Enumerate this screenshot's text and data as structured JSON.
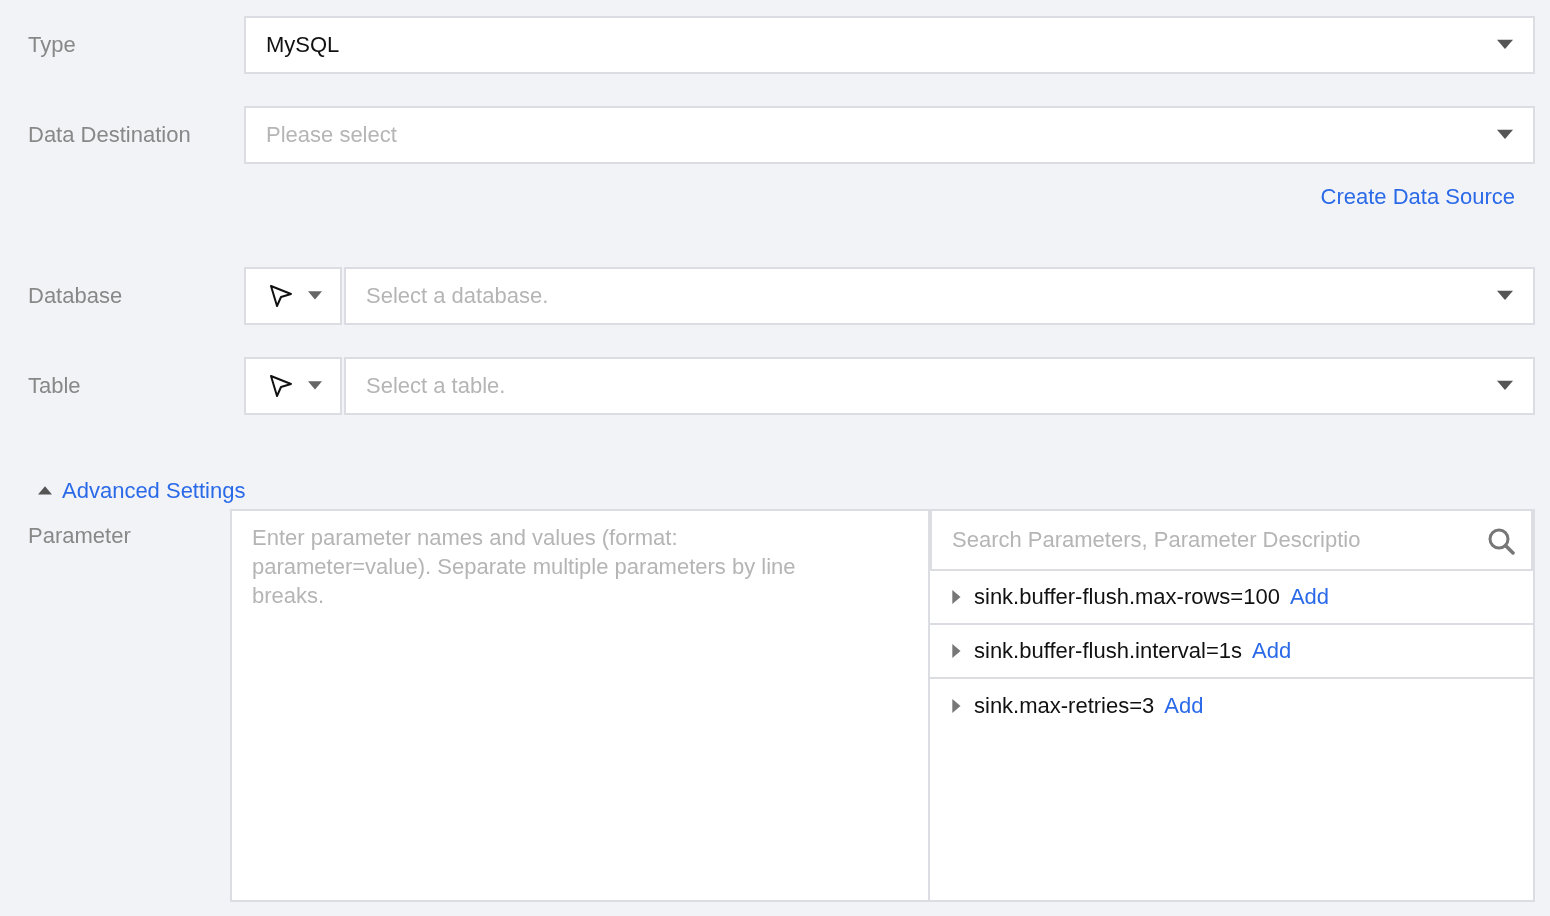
{
  "fields": [
    {
      "label": "Type",
      "kind": "select",
      "value": "MySQL"
    },
    {
      "label": "Data Destination",
      "kind": "select",
      "placeholder": "Please select",
      "link": "Create Data Source"
    },
    {
      "label": "Database",
      "kind": "picker",
      "placeholder": "Select a database."
    },
    {
      "label": "Table",
      "kind": "picker",
      "placeholder": "Select a table."
    }
  ],
  "advanced": {
    "label": "Advanced Settings",
    "expanded": true
  },
  "parameter": {
    "label": "Parameter",
    "placeholder": "Enter parameter names and values (format: parameter=value). Separate multiple parameters by line breaks.",
    "search_placeholder": "Search Parameters, Parameter Descriptio",
    "items": [
      {
        "name": "sink.buffer-flush.max-rows=100",
        "action": "Add",
        "expanded": false
      },
      {
        "name": "sink.buffer-flush.interval=1s",
        "action": "Add",
        "expanded": false
      },
      {
        "name": "sink.max-retries=3",
        "action": "Add",
        "expanded": false
      }
    ]
  }
}
